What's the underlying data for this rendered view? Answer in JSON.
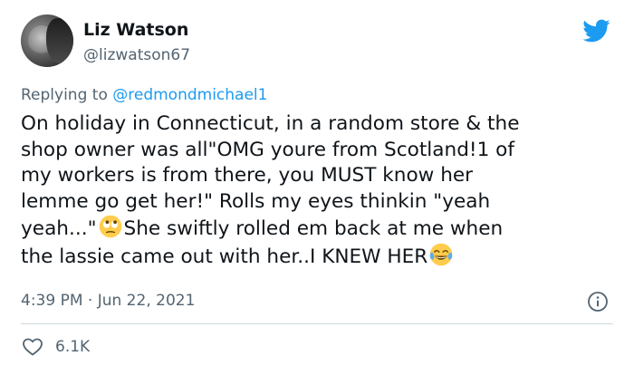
{
  "author": {
    "name": "Liz Watson",
    "handle": "@lizwatson67"
  },
  "reply": {
    "prefix": "Replying to",
    "mention": "@redmondmichael1"
  },
  "tweet": {
    "lines": [
      "On holiday in Connecticut, in a random store & the",
      "shop owner was all\"OMG youre from Scotland!1 of",
      "my workers is from there, you MUST know her",
      "lemme go get her!\" Rolls my eyes thinkin \"yeah",
      "yeah...\"",
      "She swiftly rolled em back at me when",
      "the lassie came out with her..I KNEW HER"
    ],
    "emoji_1": "face-with-rolling-eyes",
    "emoji_2": "face-with-tears-of-joy"
  },
  "meta": {
    "time": "4:39 PM",
    "separator": "·",
    "date": "Jun 22, 2021"
  },
  "stats": {
    "likes": "6.1K"
  },
  "icons": {
    "brand": "twitter-bird-icon",
    "info": "info-icon",
    "like": "heart-icon"
  },
  "colors": {
    "brand": "#1d9bf0",
    "text": "#0f1419",
    "secondary": "#536471",
    "divider": "#cfd9de"
  }
}
